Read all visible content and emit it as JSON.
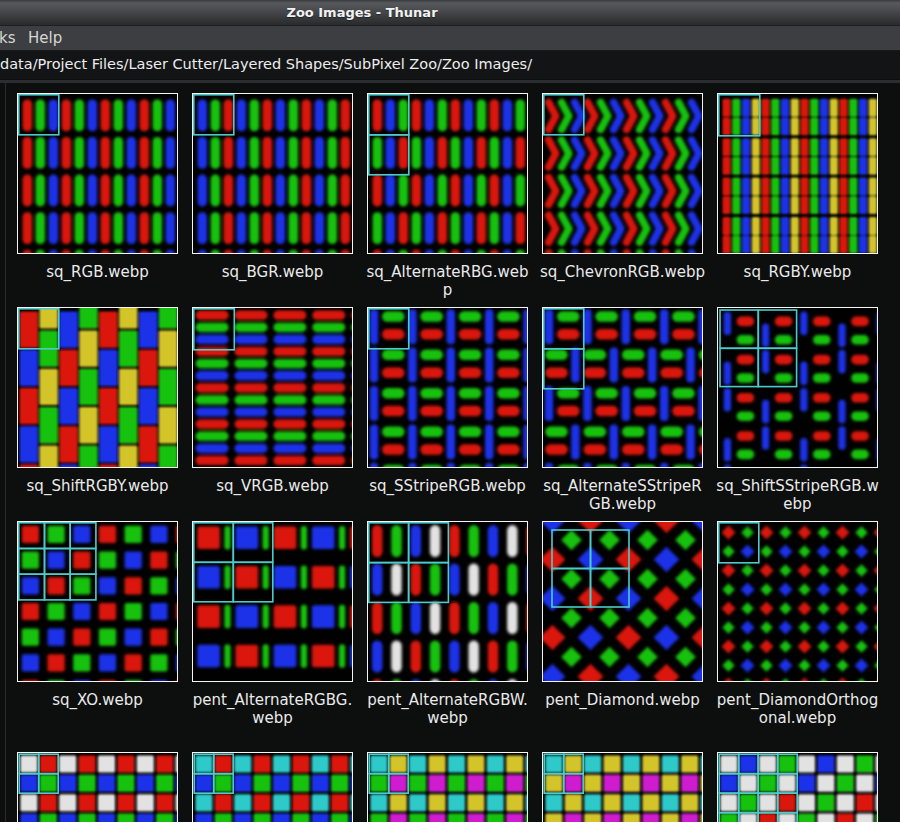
{
  "window": {
    "title": "Zoo Images - Thunar"
  },
  "menubar": {
    "items": [
      {
        "label": "ks"
      },
      {
        "label": "Help"
      }
    ]
  },
  "pathbar": {
    "path": "data/Project Files/Laser Cutter/Layered Shapes/SubPixel Zoo/Zoo Images/"
  },
  "palette": {
    "R": "#da1508",
    "G": "#17c20c",
    "B": "#1b31e8",
    "Y": "#d3c42c",
    "C": "#2fc9c9",
    "M": "#cf1fcf",
    "W": "#e2e2e2",
    "pixel_outline": "#4dcbcb",
    "thumb_border": "#f5f5f3",
    "thumb_background": "#010101"
  },
  "files": [
    {
      "name": "sq_RGB.webp",
      "lines": [
        "sq_RGB.webp"
      ],
      "pattern": "vbars",
      "seq": [
        [
          "R",
          "G",
          "B"
        ]
      ],
      "box": [
        1,
        1
      ]
    },
    {
      "name": "sq_BGR.webp",
      "lines": [
        "sq_BGR.webp"
      ],
      "pattern": "vbars",
      "seq": [
        [
          "B",
          "G",
          "R"
        ]
      ],
      "box": [
        1,
        1
      ]
    },
    {
      "name": "sq_AlternateRBG.webp",
      "lines": [
        "sq_AlternateRBG.web",
        "p"
      ],
      "pattern": "vbars",
      "seq": [
        [
          "R",
          "B",
          "G"
        ],
        [
          "G",
          "B",
          "R"
        ]
      ],
      "box": [
        1,
        2
      ]
    },
    {
      "name": "sq_ChevronRGB.webp",
      "lines": [
        "sq_ChevronRGB.webp"
      ],
      "pattern": "chevrons",
      "seq": [
        [
          "R",
          "G",
          "B"
        ]
      ],
      "box": [
        1,
        1
      ]
    },
    {
      "name": "sq_RGBY.webp",
      "lines": [
        "sq_RGBY.webp"
      ],
      "pattern": "stripes16",
      "seq": [
        [
          "R",
          "G",
          "B",
          "Y"
        ]
      ],
      "box": [
        1,
        1
      ]
    },
    {
      "name": "sq_ShiftRGBY.webp",
      "lines": [
        "sq_ShiftRGBY.webp"
      ],
      "pattern": "bricks",
      "seq": [
        [
          "R",
          "B"
        ],
        [
          "Y",
          "G"
        ],
        [
          "B",
          "R"
        ],
        [
          "G",
          "Y"
        ]
      ],
      "box": [
        1,
        1
      ]
    },
    {
      "name": "sq_VRGB.webp",
      "lines": [
        "sq_VRGB.webp"
      ],
      "pattern": "hbars",
      "seq": [
        [
          "R",
          "G",
          "B"
        ]
      ],
      "box": [
        1,
        1
      ]
    },
    {
      "name": "sq_SStripeRGB.webp",
      "lines": [
        "sq_SStripeRGB.webp"
      ],
      "pattern": "sstripe",
      "seq": [
        [
          "B",
          "G",
          "R"
        ]
      ],
      "box": [
        1,
        1
      ]
    },
    {
      "name": "sq_AlternateSStripeRGB.webp",
      "lines": [
        "sq_AlternateSStripeR",
        "GB.webp"
      ],
      "pattern": "sstripe-alt",
      "seq": [
        [
          "B",
          "G",
          "R"
        ]
      ],
      "box": [
        1,
        2
      ]
    },
    {
      "name": "sq_ShiftSStripeRGB.webp",
      "lines": [
        "sq_ShiftSStripeRGB.w",
        "ebp"
      ],
      "pattern": "sstripe-shift",
      "seq": [
        [
          "B",
          "R",
          "G"
        ]
      ],
      "box": [
        2,
        2
      ]
    },
    {
      "name": "sq_XO.webp",
      "lines": [
        "sq_XO.webp"
      ],
      "pattern": "xo",
      "seq": [
        [
          "R",
          "G",
          "B"
        ]
      ],
      "box": [
        3,
        3
      ]
    },
    {
      "name": "pent_AlternateRGBG.webp",
      "lines": [
        "pent_AlternateRGBG.",
        "webp"
      ],
      "pattern": "rgbg",
      "seq": [
        [
          "R",
          "B"
        ],
        [
          "B",
          "R"
        ]
      ],
      "box": [
        2,
        2
      ]
    },
    {
      "name": "pent_AlternateRGBW.webp",
      "lines": [
        "pent_AlternateRGBW.",
        "webp"
      ],
      "pattern": "pills",
      "seq": [
        [
          "R",
          "G",
          "B",
          "W"
        ],
        [
          "B",
          "W",
          "R",
          "G"
        ]
      ],
      "box": [
        2,
        2
      ]
    },
    {
      "name": "pent_Diamond.webp",
      "lines": [
        "pent_Diamond.webp"
      ],
      "pattern": "diamond",
      "seq": [
        [
          "B",
          "R"
        ],
        [
          "R",
          "B"
        ]
      ],
      "box": [
        2,
        2
      ]
    },
    {
      "name": "pent_DiamondOrthogonal.webp",
      "lines": [
        "pent_DiamondOrthog",
        "onal.webp"
      ],
      "pattern": "diamond-ortho",
      "seq": [
        [
          "R",
          "G"
        ],
        [
          "G",
          "B"
        ]
      ],
      "box": [
        1,
        1
      ]
    },
    {
      "name": "",
      "lines": [],
      "pattern": "quad",
      "seq": [
        [
          "W",
          "R"
        ],
        [
          "B",
          "G"
        ]
      ],
      "box": [
        2,
        2
      ]
    },
    {
      "name": "",
      "lines": [],
      "pattern": "quad",
      "seq": [
        [
          "C",
          "R"
        ],
        [
          "B",
          "G"
        ]
      ],
      "box": [
        2,
        2
      ]
    },
    {
      "name": "",
      "lines": [],
      "pattern": "quad",
      "seq": [
        [
          "C",
          "Y"
        ],
        [
          "G",
          "M"
        ]
      ],
      "box": [
        2,
        2
      ]
    },
    {
      "name": "",
      "lines": [],
      "pattern": "quad",
      "seq": [
        [
          "C",
          "Y"
        ],
        [
          "Y",
          "M"
        ]
      ],
      "box": [
        2,
        2
      ]
    },
    {
      "name": "",
      "lines": [],
      "pattern": "quad",
      "seq": [
        [
          "W",
          "B",
          "W",
          "G"
        ],
        [
          "B",
          "W",
          "G",
          "W"
        ],
        [
          "W",
          "G",
          "W",
          "R"
        ],
        [
          "G",
          "W",
          "R",
          "W"
        ]
      ],
      "box": [
        4,
        4
      ]
    }
  ]
}
